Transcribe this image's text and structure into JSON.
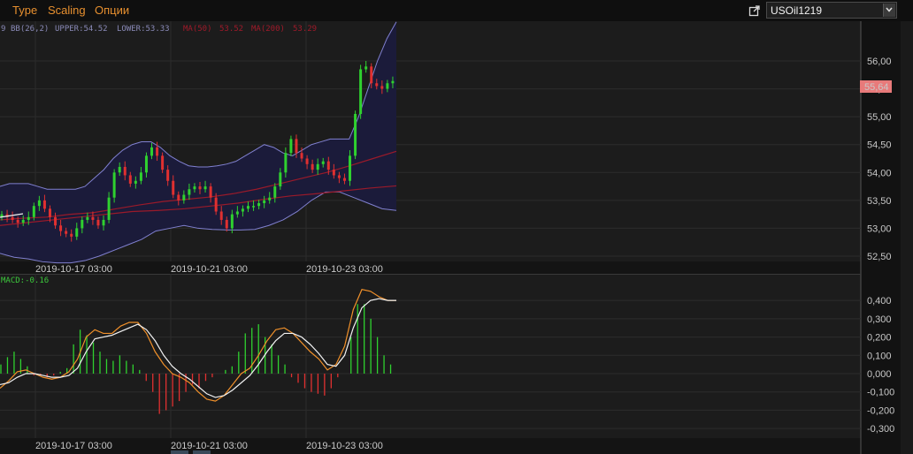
{
  "menu": {
    "type_label": "Type",
    "scaling_label": "Scaling",
    "options_label": "Опции"
  },
  "symbol": {
    "value": "USOil1219"
  },
  "price_panel": {
    "indicator_cut": "9",
    "bb_label": "BB(26,2)",
    "upper_label": "UPPER:54.52",
    "lower_label": "LOWER:53.33",
    "ma50_label": "MA(50)",
    "ma50_value": "53.52",
    "ma200_label": "MA(200)",
    "ma200_value": "53.29",
    "current_price": "55,64",
    "y_ticks": [
      "56,00",
      "55,50",
      "55,00",
      "54,50",
      "54,00",
      "53,50",
      "53,00",
      "52,50"
    ],
    "x_ticks": [
      "2019-10-17 03:00",
      "2019-10-21 03:00",
      "2019-10-23 03:00"
    ]
  },
  "macd_panel": {
    "label": "MACD:-0.16",
    "y_ticks": [
      "0,400",
      "0,300",
      "0,200",
      "0,100",
      "0,000",
      "-0,100",
      "-0,200",
      "-0,300"
    ],
    "x_ticks": [
      "2019-10-17 03:00",
      "2019-10-21 03:00",
      "2019-10-23 03:00"
    ]
  },
  "colors": {
    "accent_menu": "#e8902f",
    "bull_candle": "#2fd12f",
    "bear_candle": "#e03030",
    "bb_band": "#8080d0",
    "bb_fill": "#1b1b3a",
    "ma_line": "#9a1a2a",
    "macd_line": "#f0902a",
    "signal_line": "#f2f2f2",
    "price_tag": "#e87a7a"
  },
  "chart_data": [
    {
      "type": "candlestick",
      "title": "USOil1219",
      "x": [
        "2019-10-17 03:00",
        "2019-10-21 03:00",
        "2019-10-23 03:00"
      ],
      "ylim": [
        52.35,
        56.7
      ],
      "series": [
        {
          "name": "close",
          "values": [
            53.25,
            53.2,
            53.15,
            53.1,
            53.15,
            53.2,
            53.4,
            53.5,
            53.35,
            53.2,
            53.05,
            52.95,
            52.9,
            52.85,
            53.0,
            53.15,
            53.2,
            53.15,
            53.05,
            53.15,
            53.55,
            54.0,
            54.1,
            53.95,
            53.8,
            53.85,
            54.0,
            54.3,
            54.45,
            54.3,
            54.05,
            53.85,
            53.6,
            53.5,
            53.6,
            53.7,
            53.75,
            53.7,
            53.75,
            53.55,
            53.3,
            53.15,
            53.0,
            53.25,
            53.3,
            53.35,
            53.4,
            53.4,
            53.45,
            53.5,
            53.55,
            53.75,
            54.0,
            54.35,
            54.6,
            54.35,
            54.25,
            54.15,
            54.05,
            54.15,
            54.2,
            54.05,
            53.95,
            53.9,
            53.85,
            54.3,
            55.05,
            55.85,
            55.9,
            55.6,
            55.55,
            55.5,
            55.6,
            55.64
          ]
        },
        {
          "name": "BB upper",
          "values": [
            53.75,
            53.8,
            53.8,
            53.8,
            53.75,
            53.7,
            53.7,
            53.7,
            53.7,
            53.75,
            53.9,
            54.05,
            54.25,
            54.4,
            54.5,
            54.55,
            54.55,
            54.45,
            54.3,
            54.2,
            54.12,
            54.1,
            54.1,
            54.12,
            54.15,
            54.2,
            54.3,
            54.4,
            54.5,
            54.45,
            54.35,
            54.3,
            54.4,
            54.5,
            54.55,
            54.6,
            54.6,
            54.6,
            55.0,
            55.5,
            56.0,
            56.4,
            56.7
          ]
        },
        {
          "name": "BB lower",
          "values": [
            52.55,
            52.48,
            52.45,
            52.4,
            52.38,
            52.38,
            52.42,
            52.5,
            52.6,
            52.7,
            52.8,
            52.95,
            53.0,
            53.05,
            53.0,
            52.98,
            52.97,
            52.97,
            52.98,
            53.05,
            53.15,
            53.3,
            53.5,
            53.65,
            53.65,
            53.55,
            53.45,
            53.35,
            53.32
          ]
        },
        {
          "name": "MA(50)",
          "values": [
            53.15,
            53.18,
            53.2,
            53.25,
            53.28,
            53.35,
            53.42,
            53.48,
            53.52,
            53.56,
            53.62,
            53.7,
            53.8,
            53.9,
            54.0,
            54.12,
            54.25,
            54.38
          ]
        },
        {
          "name": "MA(200)",
          "values": [
            53.05,
            53.1,
            53.15,
            53.2,
            53.25,
            53.3,
            53.32,
            53.35,
            53.4,
            53.45,
            53.52,
            53.58,
            53.62,
            53.67,
            53.72,
            53.76
          ]
        }
      ],
      "y_ticks": [
        56.0,
        55.5,
        55.0,
        54.5,
        54.0,
        53.5,
        53.0,
        52.5
      ],
      "annotations": [
        "BB(26,2)",
        "UPPER:54.52",
        "LOWER:53.33",
        "MA(50) 53.52",
        "MA(200) 53.29"
      ]
    },
    {
      "type": "line",
      "title": "MACD",
      "x": [
        "2019-10-17 03:00",
        "2019-10-21 03:00",
        "2019-10-23 03:00"
      ],
      "ylim": [
        -0.34,
        0.5
      ],
      "series": [
        {
          "name": "MACD",
          "values": [
            -0.08,
            -0.04,
            0.01,
            0.02,
            0.0,
            -0.02,
            -0.03,
            -0.02,
            0.01,
            0.08,
            0.2,
            0.24,
            0.22,
            0.22,
            0.26,
            0.28,
            0.28,
            0.22,
            0.12,
            0.05,
            0.0,
            -0.02,
            -0.05,
            -0.1,
            -0.14,
            -0.15,
            -0.12,
            -0.06,
            0.0,
            0.03,
            0.1,
            0.18,
            0.24,
            0.25,
            0.22,
            0.17,
            0.12,
            0.08,
            0.02,
            0.05,
            0.15,
            0.35,
            0.46,
            0.45,
            0.42,
            0.4,
            0.4
          ]
        },
        {
          "name": "Signal",
          "values": [
            -0.06,
            -0.05,
            -0.02,
            0.0,
            0.0,
            -0.01,
            -0.02,
            -0.02,
            -0.01,
            0.03,
            0.12,
            0.19,
            0.2,
            0.21,
            0.23,
            0.25,
            0.27,
            0.24,
            0.18,
            0.1,
            0.04,
            0.0,
            -0.03,
            -0.07,
            -0.11,
            -0.13,
            -0.12,
            -0.09,
            -0.05,
            -0.01,
            0.05,
            0.12,
            0.18,
            0.22,
            0.22,
            0.2,
            0.16,
            0.11,
            0.05,
            0.04,
            0.1,
            0.25,
            0.36,
            0.4,
            0.41,
            0.4,
            0.4
          ]
        },
        {
          "name": "Histogram",
          "values": [
            0.05,
            0.09,
            0.12,
            0.08,
            0.04,
            -0.01,
            -0.01,
            -0.02,
            -0.01,
            0.01,
            0.03,
            0.16,
            0.24,
            0.21,
            0.17,
            0.12,
            0.08,
            0.07,
            0.1,
            0.07,
            0.05,
            0.02,
            -0.04,
            -0.1,
            -0.22,
            -0.2,
            -0.18,
            -0.15,
            -0.1,
            -0.06,
            -0.08,
            -0.04,
            -0.02,
            0.0,
            0.02,
            0.04,
            0.12,
            0.22,
            0.25,
            0.27,
            0.2,
            0.16,
            0.1,
            0.05,
            -0.02,
            -0.05,
            -0.08,
            -0.1,
            -0.11,
            -0.12,
            -0.08,
            -0.02,
            0.0,
            0.2,
            0.38,
            0.38,
            0.3,
            0.2,
            0.1,
            0.05
          ]
        }
      ],
      "y_ticks": [
        0.4,
        0.3,
        0.2,
        0.1,
        0.0,
        -0.1,
        -0.2,
        -0.3
      ]
    }
  ]
}
